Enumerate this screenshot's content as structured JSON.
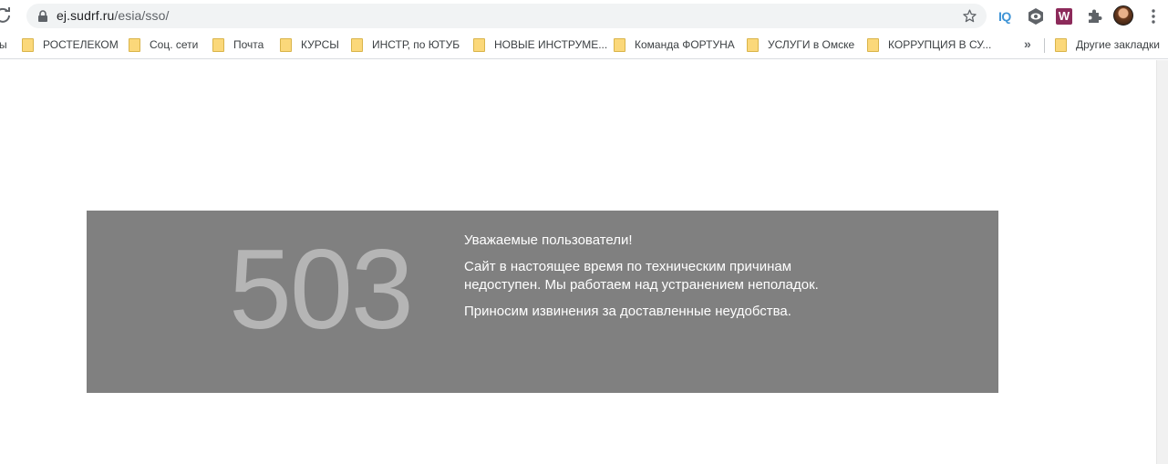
{
  "browser": {
    "url_host": "ej.sudrf.ru",
    "url_path": "/esia/sso/",
    "extensions": {
      "iq_label": "IQ",
      "w_label": "W"
    },
    "icons": [
      "reload-icon",
      "lock-icon",
      "star-icon",
      "eye-icon",
      "puzzle-icon",
      "avatar",
      "more-vert-icon"
    ]
  },
  "bookmarks": {
    "partial_left": "ы",
    "items": [
      {
        "label": "РОСТЕЛЕКОМ"
      },
      {
        "label": "Соц. сети"
      },
      {
        "label": "Почта"
      },
      {
        "label": "КУРСЫ"
      },
      {
        "label": "ИНСТР, по ЮТУБ"
      },
      {
        "label": "НОВЫЕ ИНСТРУМЕ..."
      },
      {
        "label": "Команда ФОРТУНА"
      },
      {
        "label": "УСЛУГИ в Омске"
      },
      {
        "label": "КОРРУПЦИЯ В СУ..."
      }
    ],
    "overflow": "»",
    "other": "Другие закладки"
  },
  "error": {
    "code": "503",
    "greeting": "Уважаемые пользователи!",
    "line1": "Сайт в настоящее время по техническим причинам недоступен. Мы работаем над устранением неполадок.",
    "line2": "Приносим извинения за доставленные неудобства."
  },
  "colors": {
    "box_bg": "#808080",
    "code_color": "#b5b5b5",
    "text_color": "#ffffff",
    "folder": "#fbd87a"
  }
}
